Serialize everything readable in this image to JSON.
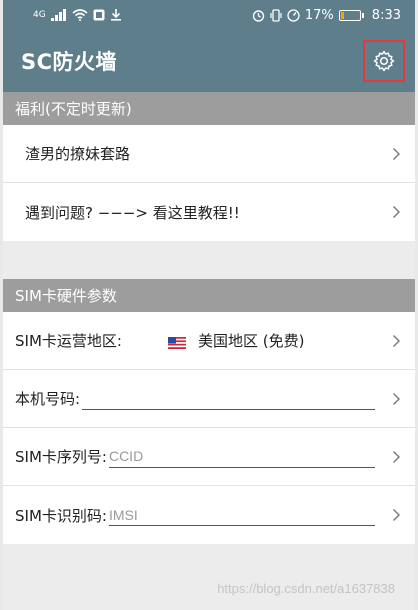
{
  "status_bar": {
    "network_label": "4G",
    "battery_percent": "17%",
    "battery_level": 0.17,
    "time": "8:33",
    "icons": [
      "signal-icon",
      "wifi-icon",
      "notification-icon",
      "download-icon",
      "alarm-icon",
      "vibrate-icon",
      "speed-icon",
      "battery-icon"
    ]
  },
  "toolbar": {
    "title": "SC防火墙",
    "settings_icon": "gear-icon"
  },
  "welfare": {
    "header": "福利(不定时更新)",
    "items": [
      {
        "label": "渣男的撩妹套路"
      },
      {
        "label": "遇到问题? −−−> 看这里教程!!"
      }
    ]
  },
  "sim": {
    "header": "SIM卡硬件参数",
    "operator_region": {
      "label": "SIM卡运营地区:",
      "value": "美国地区 (免费)",
      "flag": "us-flag-icon"
    },
    "phone_number": {
      "label": "本机号码:",
      "value": "",
      "placeholder": ""
    },
    "serial_number": {
      "label": "SIM卡序列号:",
      "value": "",
      "placeholder": "CCID"
    },
    "identifier": {
      "label": "SIM卡识别码:",
      "value": "",
      "placeholder": "IMSI"
    }
  },
  "watermark": "https://blog.csdn.net/a1637838",
  "colors": {
    "toolbar": "#5f7e8b",
    "section_header": "#9d9d9d",
    "highlight_box": "#e23a3a",
    "battery": "#f4a21c"
  }
}
